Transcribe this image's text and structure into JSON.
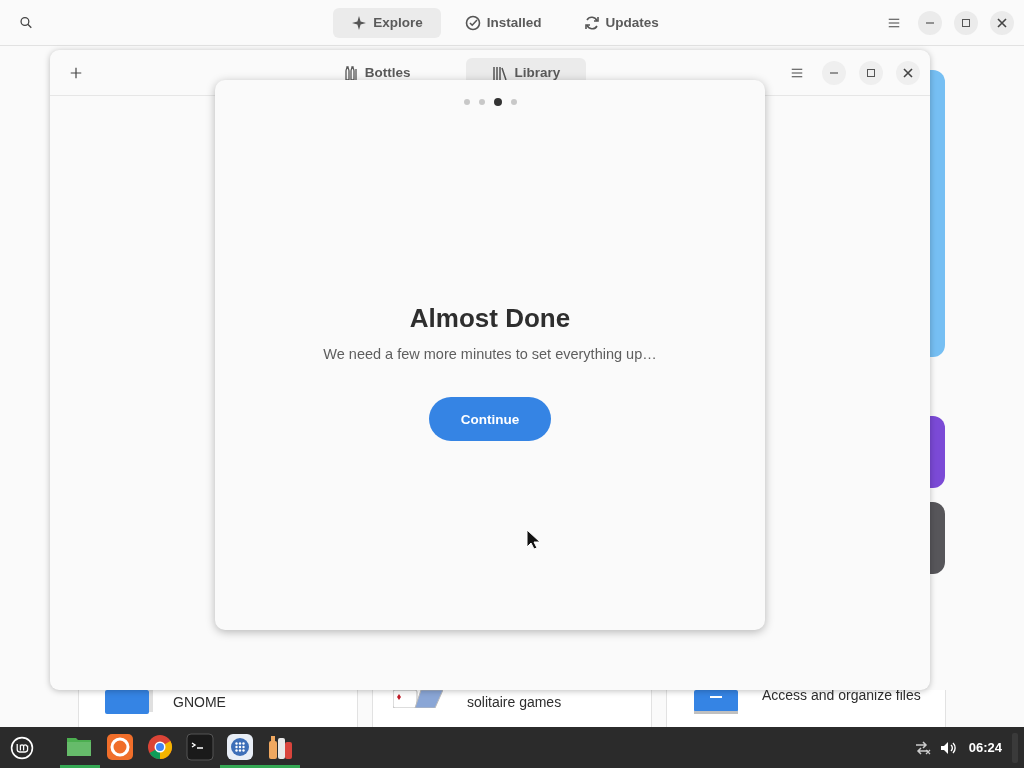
{
  "software_window": {
    "tabs": [
      {
        "label": "Explore",
        "kind": "explore",
        "selected": true
      },
      {
        "label": "Installed",
        "kind": "installed",
        "selected": false
      },
      {
        "label": "Updates",
        "kind": "updates",
        "selected": false
      }
    ],
    "cards": [
      {
        "kind": "contacts",
        "lines": [
          "GNOME"
        ]
      },
      {
        "kind": "solitaire",
        "lines": [
          "solitaire games"
        ]
      },
      {
        "kind": "files",
        "lines": [
          "Access and organize files"
        ]
      }
    ]
  },
  "bottles_window": {
    "tabs": [
      {
        "label": "Bottles",
        "kind": "bottles",
        "selected": false
      },
      {
        "label": "Library",
        "kind": "library",
        "selected": true
      }
    ]
  },
  "dialog": {
    "pages": [
      {
        "selected": false
      },
      {
        "selected": false
      },
      {
        "selected": true
      },
      {
        "selected": false
      }
    ],
    "title": "Almost Done",
    "subtitle": "We need a few more minutes to set everything up…",
    "button": "Continue"
  },
  "taskbar": {
    "apps": [
      {
        "kind": "folder",
        "running": true
      },
      {
        "kind": "firefox",
        "running": false
      },
      {
        "kind": "chrome",
        "running": false
      },
      {
        "kind": "terminal",
        "running": false
      },
      {
        "kind": "grid",
        "running": true
      },
      {
        "kind": "bottles",
        "running": true
      }
    ],
    "clock": "06:24"
  }
}
